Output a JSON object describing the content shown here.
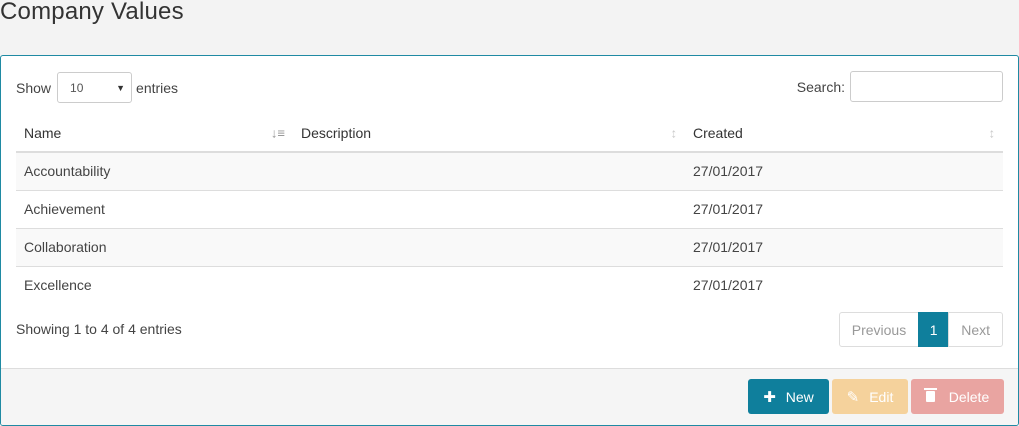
{
  "page": {
    "title": "Company Values"
  },
  "controls": {
    "show_label": "Show",
    "page_length": "10",
    "entries_label": "entries",
    "search_label": "Search:",
    "search_value": ""
  },
  "table": {
    "columns": [
      "Name",
      "Description",
      "Created"
    ],
    "rows": [
      {
        "name": "Accountability",
        "description": "",
        "created": "27/01/2017"
      },
      {
        "name": "Achievement",
        "description": "",
        "created": "27/01/2017"
      },
      {
        "name": "Collaboration",
        "description": "",
        "created": "27/01/2017"
      },
      {
        "name": "Excellence",
        "description": "",
        "created": "27/01/2017"
      }
    ]
  },
  "footer_info": "Showing 1 to 4 of 4 entries",
  "pagination": {
    "previous": "Previous",
    "current": "1",
    "next": "Next"
  },
  "actions": {
    "new_label": "New",
    "edit_label": "Edit",
    "delete_label": "Delete",
    "new_icon": "plus-icon",
    "edit_icon": "pencil-icon",
    "delete_icon": "trash-icon"
  },
  "colors": {
    "primary": "#0f7f9c",
    "warning": "#f5d29c",
    "danger": "#e9a4a1"
  }
}
